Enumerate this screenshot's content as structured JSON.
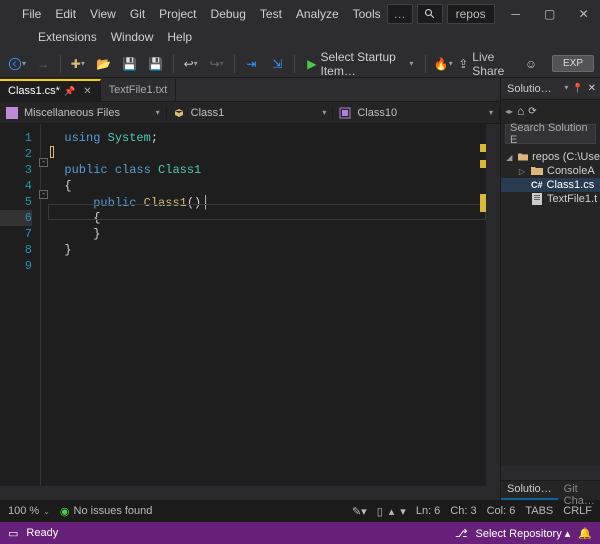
{
  "menubar": {
    "items": [
      "File",
      "Edit",
      "View",
      "Git",
      "Project",
      "Debug",
      "Test",
      "Analyze",
      "Tools",
      "Extensions",
      "Window",
      "Help"
    ]
  },
  "titlebar": {
    "repo_badge": "repos",
    "search_placeholder": "…"
  },
  "toolbar": {
    "startup_label": "Select Startup Item…",
    "liveshare": "Live Share",
    "exp": "EXP"
  },
  "tabs": [
    {
      "label": "Class1.cs*",
      "active": true
    },
    {
      "label": "TextFile1.txt",
      "active": false
    }
  ],
  "navbar": {
    "project": "Miscellaneous Files",
    "class": "Class1",
    "member": "Class10"
  },
  "editor": {
    "line_numbers": [
      "1",
      "2",
      "3",
      "4",
      "5",
      "6",
      "7",
      "8",
      "9"
    ],
    "caret_line": 6
  },
  "code": {
    "l1_kw": "using",
    "l1_ns": "System",
    "l1_semi": ";",
    "l3_pub": "public",
    "l3_cls": "class",
    "l3_name": "Class1",
    "l4_brace": "{",
    "l5_pub": "public",
    "l5_ctor": "Class1",
    "l5_par": "()",
    "l6_brace": "{",
    "l7_brace": "}",
    "l8_brace": "}"
  },
  "solution": {
    "title": "Solutio…",
    "search": "Search Solution E",
    "items": [
      {
        "twist": "◢",
        "icon": "folder",
        "label": "repos (C:\\Use"
      },
      {
        "twist": "▷",
        "icon": "folder",
        "label": "ConsoleA",
        "indent": 1
      },
      {
        "twist": "",
        "icon": "cs",
        "label": "Class1.cs",
        "indent": 1,
        "selected": true
      },
      {
        "twist": "",
        "icon": "txt",
        "label": "TextFile1.t",
        "indent": 1
      }
    ],
    "tabs": [
      "Solutio…",
      "Git Cha…"
    ]
  },
  "infobar": {
    "zoom": "100 %",
    "issues": "No issues found",
    "ln": "Ln: 6",
    "ch": "Ch: 3",
    "col": "Col: 6",
    "tabs": "TABS",
    "crlf": "CRLF"
  },
  "statusbar": {
    "ready": "Ready",
    "repo": "Select Repository"
  }
}
